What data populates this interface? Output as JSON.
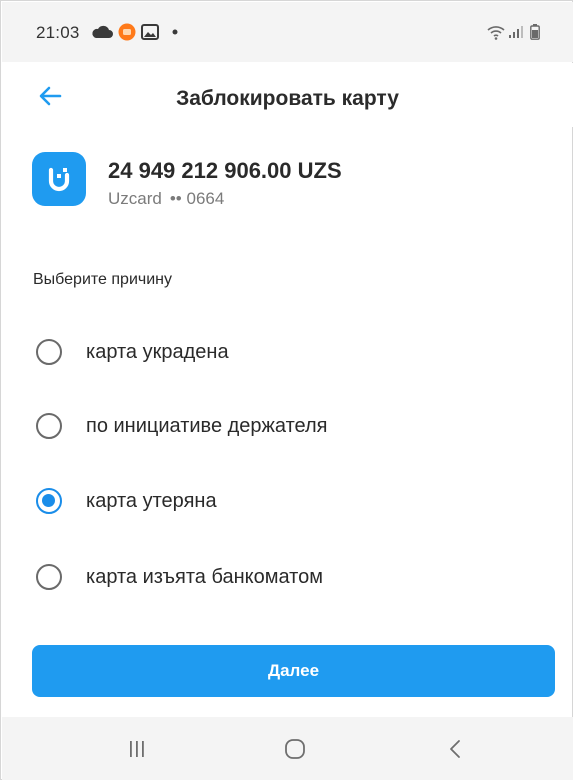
{
  "status_bar": {
    "time": "21:03",
    "icons": [
      "cloud-icon",
      "app-notification-icon",
      "gallery-icon",
      "dot-icon",
      "wifi-icon",
      "signal-icon",
      "battery-icon"
    ]
  },
  "header": {
    "title": "Заблокировать карту",
    "back_icon": "arrow-left-icon"
  },
  "card": {
    "amount": "24 949 212 906.00 UZS",
    "brand": "Uzcard",
    "masked_number": "•• 0664",
    "logo_letter": "U"
  },
  "reason": {
    "label": "Выберите причину",
    "options": [
      {
        "label": "карта украдена",
        "checked": false
      },
      {
        "label": "по инициативе держателя",
        "checked": false
      },
      {
        "label": "карта утеряна",
        "checked": true
      },
      {
        "label": "карта изъята банкоматом",
        "checked": false
      }
    ]
  },
  "actions": {
    "next_label": "Далее"
  },
  "nav": {
    "items": [
      "recents-icon",
      "home-icon",
      "back-icon"
    ]
  },
  "colors": {
    "accent": "#1f9bf0",
    "radio_checked": "#1a8de9",
    "status_bg": "#f4f4f4"
  }
}
